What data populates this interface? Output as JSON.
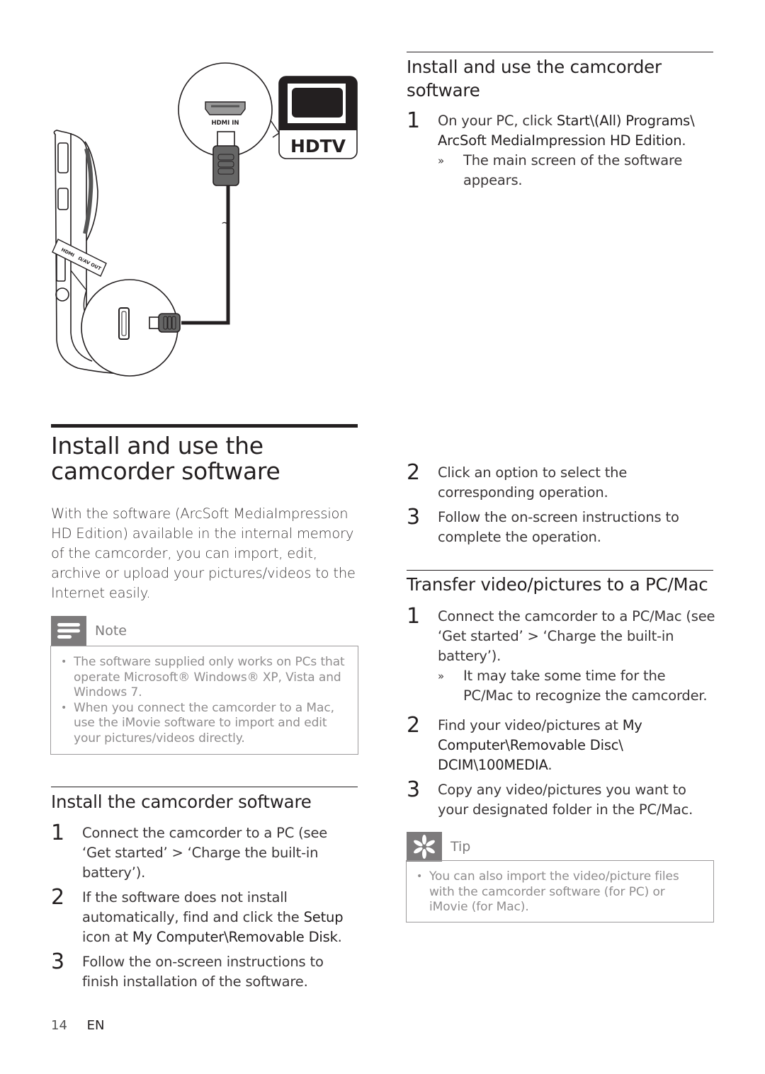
{
  "illustration": {
    "tv_port_label": "HDMI IN",
    "tv_label": "HDTV",
    "camera_port_labels": [
      "HDMI",
      "Ω/AV OUT"
    ]
  },
  "left": {
    "title": "Install and use the camcorder software",
    "intro": "With the software (ArcSoft MediaImpression HD Edition) available in the internal memory of the camcorder, you can import, edit, archive or upload your pictures/videos to the Internet easily.",
    "note": {
      "icon": "note-lines-icon",
      "label": "Note",
      "items": [
        "The software supplied only works on PCs that operate Microsoft® Windows® XP, Vista and Windows 7.",
        "When you connect the camcorder to a Mac, use the iMovie software to import and edit your pictures/videos directly."
      ]
    },
    "install": {
      "title": "Install the camcorder software",
      "steps": [
        {
          "num": "1",
          "text": "Connect the camcorder to a PC (see ‘Get started’ > ‘Charge the built-in battery’)."
        },
        {
          "num": "2",
          "text_before": "If the software does not install automatically, find and click the ",
          "bold1": "Setup",
          "text_mid": " icon at ",
          "bold2": "My Computer\\Removable Disk",
          "text_after": "."
        },
        {
          "num": "3",
          "text": "Follow the on-screen instructions to finish installation of the software."
        }
      ]
    }
  },
  "right": {
    "use": {
      "title": "Install and use the camcorder software",
      "steps": [
        {
          "num": "1",
          "text_before": "On your PC, click ",
          "bold": "Start\\(All) Programs\\ ArcSoft MediaImpression HD Edition",
          "text_after": ".",
          "result_marker": "»",
          "result": "The main screen of the software appears."
        },
        {
          "num": "2",
          "text": "Click an option to select the corresponding operation."
        },
        {
          "num": "3",
          "text": "Follow the on-screen instructions to complete the operation."
        }
      ]
    },
    "transfer": {
      "title": "Transfer video/pictures to a PC/Mac",
      "steps": [
        {
          "num": "1",
          "text": "Connect the camcorder to a PC/Mac (see ‘Get started’ > ‘Charge the built-in battery’).",
          "result_marker": "»",
          "result": "It may take some time for the PC/Mac to recognize the camcorder."
        },
        {
          "num": "2",
          "text_before": "Find your video/pictures at ",
          "bold": "My Computer\\Removable Disc\\ DCIM\\100MEDIA",
          "text_after": "."
        },
        {
          "num": "3",
          "text": "Copy any video/pictures you want to your designated folder in the PC/Mac."
        }
      ]
    },
    "tip": {
      "icon": "tip-asterisk-icon",
      "label": "Tip",
      "items": [
        "You can also import the video/picture files with the camcorder software (for PC) or iMovie (for Mac)."
      ]
    }
  },
  "footer": {
    "page_number": "14",
    "language": "EN"
  }
}
